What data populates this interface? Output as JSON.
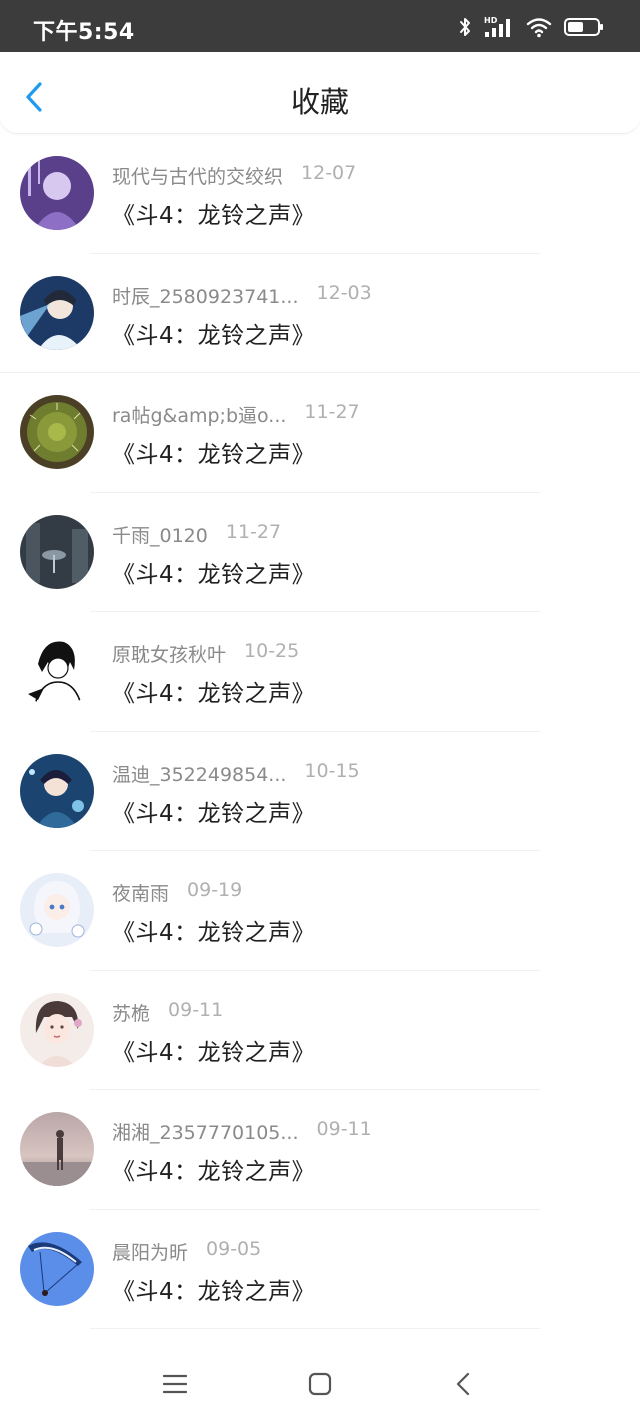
{
  "status_bar": {
    "time": "下午5:54",
    "icons": [
      "bluetooth-icon",
      "hd-signal-icon",
      "wifi-icon",
      "battery-icon"
    ]
  },
  "header": {
    "title": "收藏",
    "back_icon": "chevron-left-icon",
    "accent_color": "#1e9bf0"
  },
  "favorites": [
    {
      "username": "现代与古代的交绞织",
      "date": "12-07",
      "title": "《斗4：龙铃之声》",
      "avatar": {
        "bg": "#5a3f8a",
        "fg": "#d7c8f0"
      }
    },
    {
      "username": "时辰_2580923741...",
      "date": "12-03",
      "title": "《斗4：龙铃之声》",
      "avatar": {
        "bg": "#1d3a66",
        "fg": "#8fd0ff"
      }
    },
    {
      "username": "ra帖g&amp;b逼o...",
      "date": "11-27",
      "title": "《斗4：龙铃之声》",
      "avatar": {
        "bg": "#5e6b2a",
        "fg": "#a9b84a"
      }
    },
    {
      "username": "千雨_0120",
      "date": "11-27",
      "title": "《斗4：龙铃之声》",
      "avatar": {
        "bg": "#333c44",
        "fg": "#8a98a4"
      }
    },
    {
      "username": "原耽女孩秋叶",
      "date": "10-25",
      "title": "《斗4：龙铃之声》",
      "avatar": {
        "bg": "#ffffff",
        "fg": "#111111"
      }
    },
    {
      "username": "温迪_352249854...",
      "date": "10-15",
      "title": "《斗4：龙铃之声》",
      "avatar": {
        "bg": "#1c4470",
        "fg": "#7fc2e8"
      }
    },
    {
      "username": "夜南雨",
      "date": "09-19",
      "title": "《斗4：龙铃之声》",
      "avatar": {
        "bg": "#e8eef8",
        "fg": "#9fb4da"
      }
    },
    {
      "username": "苏桅",
      "date": "09-11",
      "title": "《斗4：龙铃之声》",
      "avatar": {
        "bg": "#f4ece8",
        "fg": "#5a4844"
      }
    },
    {
      "username": "湘湘_2357770105...",
      "date": "09-11",
      "title": "《斗4：龙铃之声》",
      "avatar": {
        "bg": "#b9a6a8",
        "fg": "#4a3c3c"
      }
    },
    {
      "username": "晨阳为昕",
      "date": "09-05",
      "title": "《斗4：龙铃之声》",
      "avatar": {
        "bg": "#5a8ee8",
        "fg": "#1a3a7a"
      }
    }
  ],
  "nav_bar": {
    "icons": [
      "menu-icon",
      "home-icon",
      "back-icon"
    ]
  }
}
